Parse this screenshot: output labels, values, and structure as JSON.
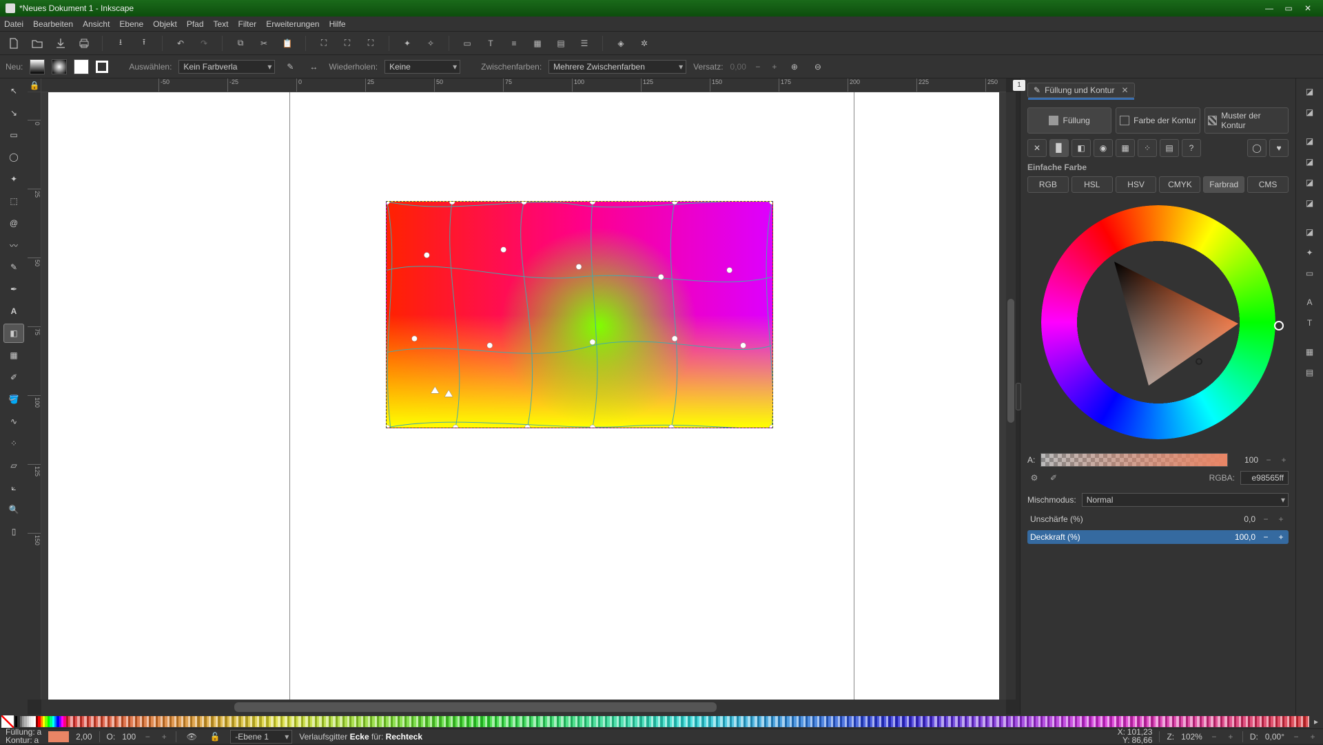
{
  "title": "*Neues Dokument 1 - Inkscape",
  "menu": [
    "Datei",
    "Bearbeiten",
    "Ansicht",
    "Ebene",
    "Objekt",
    "Pfad",
    "Text",
    "Filter",
    "Erweiterungen",
    "Hilfe"
  ],
  "toolbar2": {
    "neu": "Neu:",
    "auswaehlen": "Auswählen:",
    "gradtype": "Kein Farbverla",
    "wiederholen": "Wiederholen:",
    "wiederholen_val": "Keine",
    "zwischenfarben": "Zwischenfarben:",
    "zwischenfarben_val": "Mehrere Zwischenfarben",
    "versatz": "Versatz:",
    "versatz_val": "0,00"
  },
  "ruler_top": [
    "-50",
    "-25",
    "0",
    "25",
    "50",
    "75",
    "100",
    "125",
    "150",
    "175",
    "200",
    "225",
    "250"
  ],
  "ruler_left": [
    "0",
    "25",
    "50",
    "75",
    "100",
    "125",
    "150"
  ],
  "pagebadge": "1",
  "panel": {
    "tab": "Füllung und Kontur",
    "tabs": {
      "fill": "Füllung",
      "stroke": "Farbe der Kontur",
      "strokestyle": "Muster der Kontur"
    },
    "section": "Einfache Farbe",
    "modes": [
      "RGB",
      "HSL",
      "HSV",
      "CMYK",
      "Farbrad",
      "CMS"
    ],
    "active_mode": "Farbrad",
    "alpha_label": "A:",
    "alpha_val": "100",
    "rgba_label": "RGBA:",
    "rgba_val": "e98565ff",
    "mixmode_label": "Mischmodus:",
    "mixmode_val": "Normal",
    "blur_label": "Unschärfe (%)",
    "blur_val": "0,0",
    "opacity_label": "Deckkraft (%)",
    "opacity_val": "100,0"
  },
  "status": {
    "fill_label": "Füllung:",
    "stroke_label": "Kontur:",
    "fill_a": "a",
    "stroke_a": "a",
    "stroke_w": "2,00",
    "o_label": "O:",
    "o_val": "100",
    "layer": "-Ebene 1",
    "msg_pre": "Verlaufsgitter ",
    "msg_b1": "Ecke",
    "msg_mid": " für: ",
    "msg_b2": "Rechteck",
    "x_label": "X:",
    "x": "101,23",
    "y_label": "Y:",
    "y": "86,66",
    "z_label": "Z:",
    "z": "102%",
    "d_label": "D:",
    "d": "0,00°"
  },
  "palette_colors": [
    "#000",
    "#333",
    "#666",
    "#999",
    "#b3b3b3",
    "#ccc",
    "#e6e6e6",
    "#f2f2f2",
    "#fff",
    "#800000",
    "#f00",
    "#ff8000",
    "#ff0",
    "#80ff00",
    "#0f0",
    "#00ff80",
    "#0ff",
    "#0080ff",
    "#00f",
    "#8000ff",
    "#f0f",
    "#ff0080"
  ]
}
